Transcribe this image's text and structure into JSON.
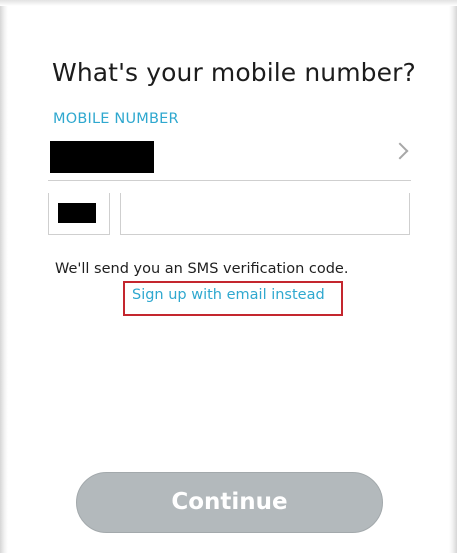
{
  "page": {
    "title": "What's your mobile number?"
  },
  "form": {
    "field_label": "MOBILE NUMBER",
    "country_value": "",
    "dial_code_value": "",
    "phone_value": "",
    "phone_placeholder": ""
  },
  "sms_note": "We'll send you an SMS verification code.",
  "email_link": "Sign up with email instead",
  "continue_button": "Continue",
  "colors": {
    "accent": "#2fa8cf",
    "highlight_box": "#c4262e",
    "button_disabled": "#b3b9bc",
    "redaction": "#000000"
  },
  "icons": {
    "country_selector": "chevron-right-icon"
  }
}
